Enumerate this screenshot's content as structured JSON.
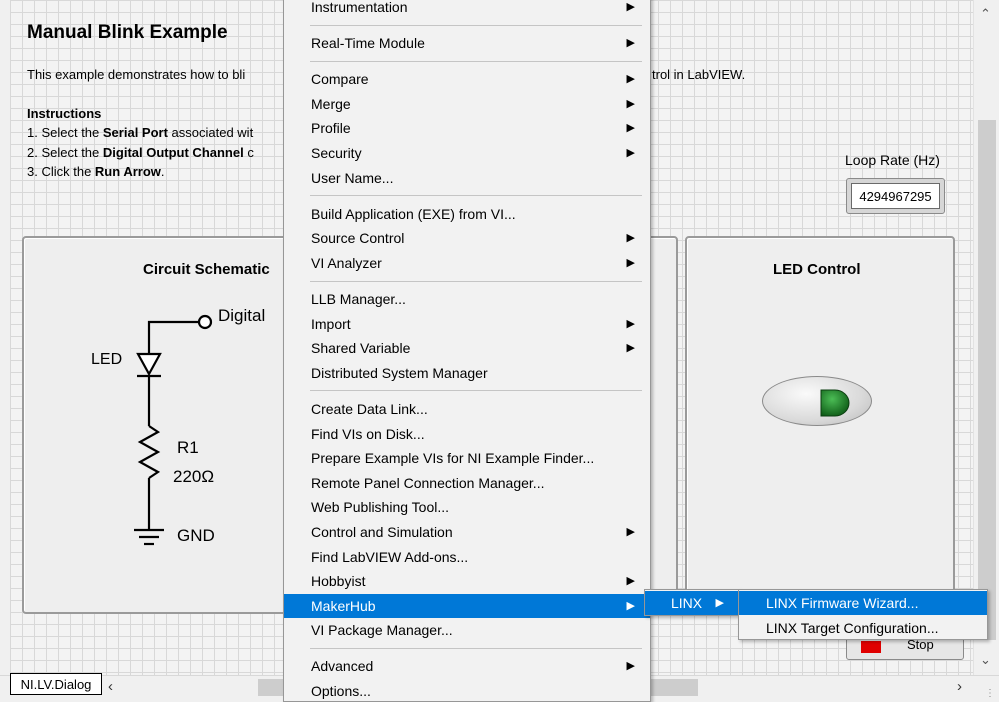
{
  "front_panel": {
    "title": "Manual Blink Example",
    "description_start": "This example demonstrates how to bli",
    "description_end": "trol in LabVIEW.",
    "instructions_title": "Instructions",
    "instructions": [
      {
        "prefix": "1. Select the ",
        "bold": "Serial Port",
        "suffix": " associated wit"
      },
      {
        "prefix": "2. Select the ",
        "bold": "Digital Output Channel",
        "suffix": " c"
      },
      {
        "prefix": "3. Click the ",
        "bold": "Run Arrow",
        "suffix": "."
      }
    ],
    "loop_rate_label": "Loop Rate (Hz)",
    "loop_rate_value": "4294967295",
    "schematic_title": "Circuit Schematic",
    "schematic_labels": {
      "digital": "Digital",
      "led": "LED",
      "resistor": "R1",
      "resistance": "220Ω",
      "ground": "GND"
    },
    "led_control_title": "LED Control",
    "led_color": "#1e7a2a",
    "stop_label": "Stop",
    "vi_label": "NI.LV.Dialog"
  },
  "tools_menu": {
    "items": [
      {
        "label": "Instrumentation",
        "submenu": true
      },
      {
        "separator": true
      },
      {
        "label": "Real-Time Module",
        "submenu": true
      },
      {
        "separator": true
      },
      {
        "label": "Compare",
        "submenu": true
      },
      {
        "label": "Merge",
        "submenu": true
      },
      {
        "label": "Profile",
        "submenu": true
      },
      {
        "label": "Security",
        "submenu": true
      },
      {
        "label": "User Name...",
        "submenu": false
      },
      {
        "separator": true
      },
      {
        "label": "Build Application (EXE) from VI...",
        "submenu": false
      },
      {
        "label": "Source Control",
        "submenu": true
      },
      {
        "label": "VI Analyzer",
        "submenu": true
      },
      {
        "separator": true
      },
      {
        "label": "LLB Manager...",
        "submenu": false
      },
      {
        "label": "Import",
        "submenu": true
      },
      {
        "label": "Shared Variable",
        "submenu": true
      },
      {
        "label": "Distributed System Manager",
        "submenu": false
      },
      {
        "separator": true
      },
      {
        "label": "Create Data Link...",
        "submenu": false
      },
      {
        "label": "Find VIs on Disk...",
        "submenu": false
      },
      {
        "label": "Prepare Example VIs for NI Example Finder...",
        "submenu": false
      },
      {
        "label": "Remote Panel Connection Manager...",
        "submenu": false
      },
      {
        "label": "Web Publishing Tool...",
        "submenu": false
      },
      {
        "label": "Control and Simulation",
        "submenu": true
      },
      {
        "label": "Find LabVIEW Add-ons...",
        "submenu": false
      },
      {
        "label": "Hobbyist",
        "submenu": true
      },
      {
        "label": "MakerHub",
        "submenu": true,
        "highlighted": true
      },
      {
        "label": "VI Package Manager...",
        "submenu": false
      },
      {
        "separator": true
      },
      {
        "label": "Advanced",
        "submenu": true
      },
      {
        "label": "Options...",
        "submenu": false
      }
    ]
  },
  "makerhub_menu": {
    "items": [
      {
        "label": "LINX",
        "submenu": true,
        "highlighted": true
      }
    ]
  },
  "linx_menu": {
    "items": [
      {
        "label": "LINX Firmware Wizard...",
        "submenu": false,
        "highlighted": true
      },
      {
        "label": "LINX Target Configuration...",
        "submenu": false
      }
    ]
  },
  "colors": {
    "highlight": "#0078d7",
    "stop_red": "#e00000"
  }
}
